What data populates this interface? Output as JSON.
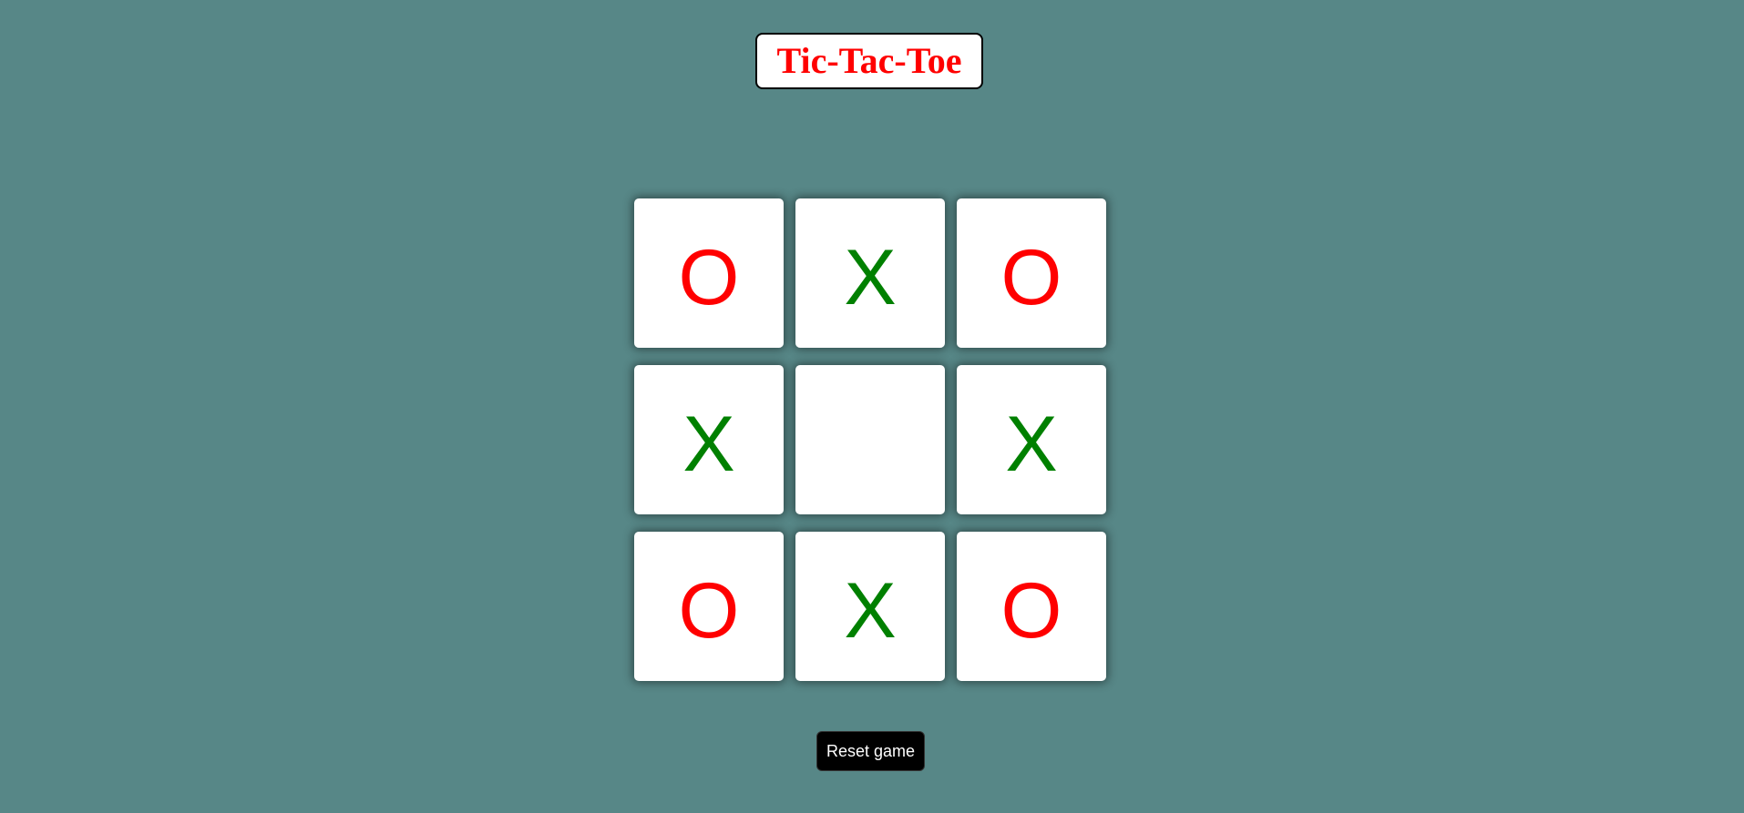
{
  "title": "Tic-Tac-Toe",
  "board": {
    "cells": [
      {
        "mark": "O",
        "type": "o"
      },
      {
        "mark": "X",
        "type": "x"
      },
      {
        "mark": "O",
        "type": "o"
      },
      {
        "mark": "X",
        "type": "x"
      },
      {
        "mark": "",
        "type": "empty"
      },
      {
        "mark": "X",
        "type": "x"
      },
      {
        "mark": "O",
        "type": "o"
      },
      {
        "mark": "X",
        "type": "x"
      },
      {
        "mark": "O",
        "type": "o"
      }
    ]
  },
  "reset_label": "Reset game",
  "colors": {
    "background": "#578787",
    "o_mark": "#ff0000",
    "x_mark": "#008000",
    "title": "#ff0000",
    "button_bg": "#000000"
  }
}
